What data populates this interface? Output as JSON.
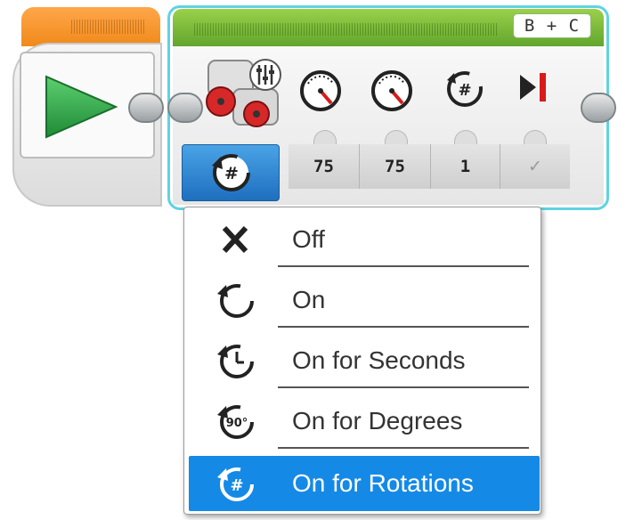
{
  "start_block": {
    "play_icon": "play-triangle-icon"
  },
  "motor_block": {
    "ports": "B + C",
    "motor_icon": "large-motor-pair-icon",
    "settings_icon": "sliders-icon",
    "param_icons": [
      "steering-dial-icon",
      "power-dial-icon",
      "rotations-icon",
      "brake-at-end-icon"
    ],
    "params": [
      "75",
      "75",
      "1",
      "✓"
    ],
    "mode_icon": "rotations-mode-icon"
  },
  "mode_menu": {
    "items": [
      {
        "label": "Off",
        "icon": "x-icon",
        "selected": false
      },
      {
        "label": "On",
        "icon": "rotate-icon",
        "selected": false
      },
      {
        "label": "On for Seconds",
        "icon": "clock-icon",
        "selected": false
      },
      {
        "label": "On for Degrees",
        "icon": "degrees-icon",
        "selected": false
      },
      {
        "label": "On for Rotations",
        "icon": "rotations-icon",
        "selected": true
      }
    ]
  },
  "colors": {
    "start_header": "#f08a1a",
    "motor_header": "#5fa32c",
    "selection": "#1589e6",
    "play": "#2ea84a",
    "brake": "#d91a1a"
  }
}
